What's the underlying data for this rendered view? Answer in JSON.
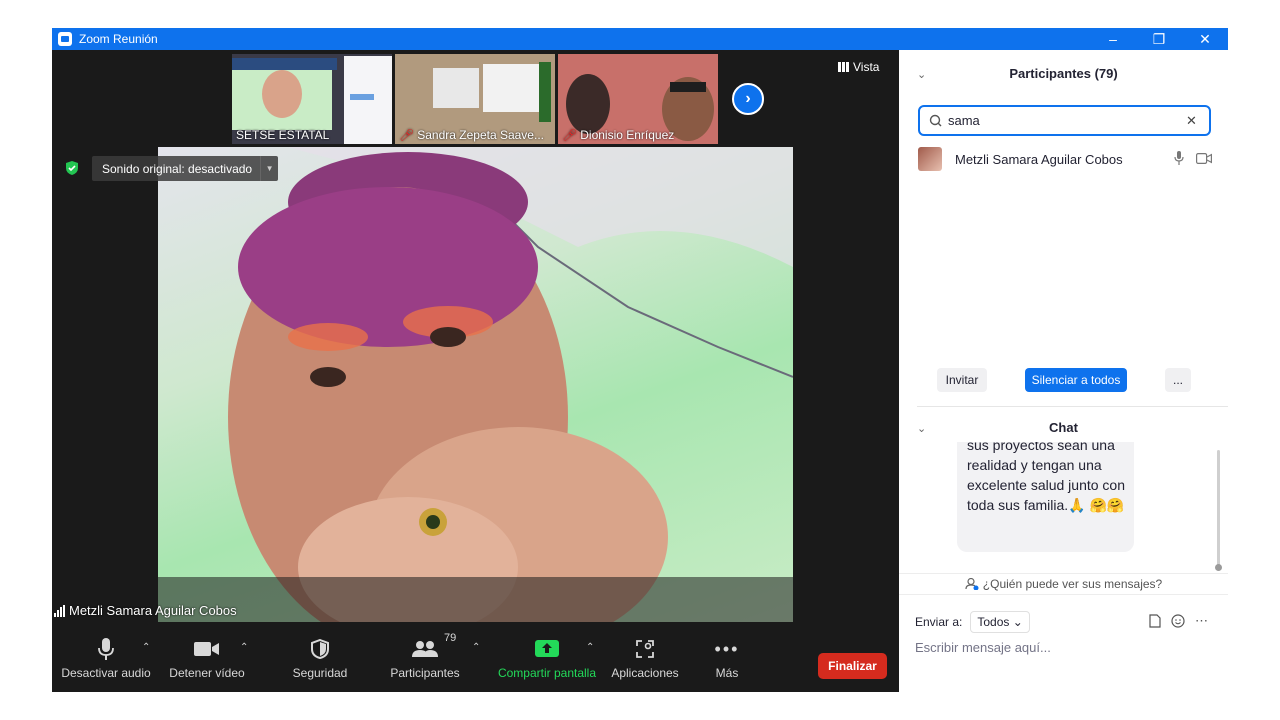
{
  "window": {
    "title": "Zoom Reunión",
    "controls": [
      "minimize",
      "restore",
      "close"
    ]
  },
  "thumbnails": [
    {
      "name": "SETSE ESTATAL",
      "muted": false
    },
    {
      "name": "Sandra Zepeta Saave...",
      "muted": true
    },
    {
      "name": "Dionisio Enríquez",
      "muted": true
    }
  ],
  "view_label": "Vista",
  "sound_chip": "Sonido original: desactivado",
  "speaker_name": "Metzli Samara Aguilar Cobos",
  "toolbar": {
    "audio": "Desactivar audio",
    "video": "Detener vídeo",
    "security": "Seguridad",
    "participants": "Participantes",
    "participants_count": "79",
    "share": "Compartir pantalla",
    "apps": "Aplicaciones",
    "more": "Más",
    "end": "Finalizar"
  },
  "participants_panel": {
    "title": "Participantes (79)",
    "search_value": "sama",
    "results": [
      {
        "name": "Metzli Samara Aguilar Cobos"
      }
    ],
    "invite": "Invitar",
    "mute_all": "Silenciar a todos",
    "more": "..."
  },
  "chat_panel": {
    "title": "Chat",
    "message": "sus proyectos sean una realidad y tengan una excelente salud junto con toda sus familia.🙏 🤗🤗",
    "who_can_see": "¿Quién puede ver sus mensajes?",
    "send_to_label": "Enviar a:",
    "send_to_value": "Todos",
    "input_placeholder": "Escribir mensaje aquí..."
  },
  "colors": {
    "accent": "#0e72ed",
    "end": "#d52b1e",
    "share": "#23d959"
  }
}
